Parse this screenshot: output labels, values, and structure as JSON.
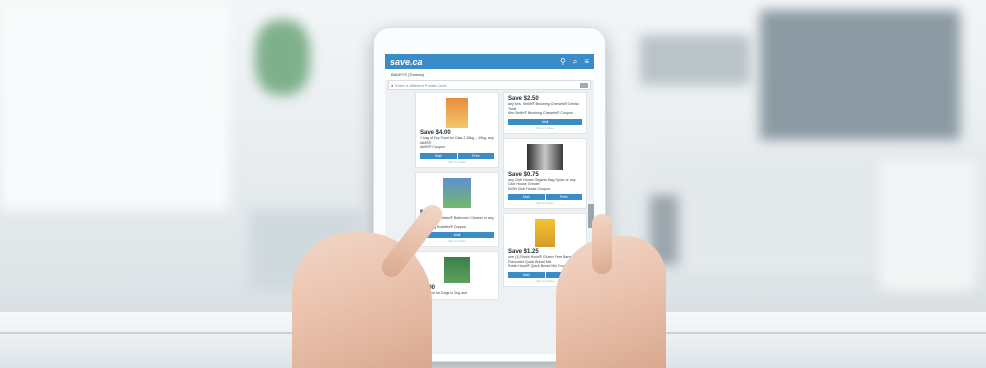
{
  "app": {
    "logo": "save.ca"
  },
  "header": {
    "location_icon": "location-pin-icon",
    "search_icon": "search-icon",
    "menu_icon": "menu-icon",
    "region": "BAKEYS (Toronto)"
  },
  "postal": {
    "placeholder": "Enter a different Postal Code",
    "go_icon": "arrow-right-icon"
  },
  "coupons": {
    "left": [
      {
        "save": "Save $4.00",
        "desc": "1 bag of Dry Food for Cats 2.26kg – 10kg, any IAMS®",
        "brand": "IAMS® Coupon",
        "mail": "Mail",
        "print": "Print",
        "note": "Clip it 2 Save"
      },
      {
        "save": "$2.00",
        "desc": "Scrubbing Bubbles® Bathroom Cleaner or any Refresh",
        "brand": "Scrubbing Bubbles® Coupon",
        "mail": "Mail",
        "note": "Clip it 2 Save"
      },
      {
        "save": "$0.00",
        "desc": "Dry Food for Dogs in 2kg and",
        "brand": "IAMS"
      }
    ],
    "right": [
      {
        "save": "Save $2.50",
        "desc": "any Mrs. Smith® Brushing Chewels® Dental Treat",
        "brand": "Mrs.Smith® Brushing Chewels® Coupon",
        "mail": "Mail",
        "note": "Clip it 2 Save"
      },
      {
        "save": "Save $0.75",
        "desc": "any Club House Organic Bag Spice or any Club House Grinder",
        "brand": "NOW Club House Coupon",
        "mail": "Mail",
        "print": "Print",
        "note": "Clip it 2 Save"
      },
      {
        "save": "Save $1.25",
        "desc": "one (1) Robin Hood® Gluten Free Banana Flavoured Quick Bread Mix",
        "brand": "Robin Hood® Quick Bread Mix Coupon",
        "mail": "Mail",
        "print": "Print",
        "note": "Clip it 2 Save"
      }
    ]
  },
  "colors": {
    "accent": "#3a8cc8"
  }
}
